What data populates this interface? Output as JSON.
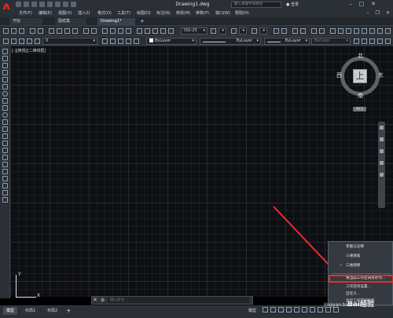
{
  "app": {
    "logo_letter": "A",
    "doc_title": "Drawing1.dwg",
    "search_placeholder": "键入关键字或短语",
    "user_label": "登录"
  },
  "menu": {
    "items": [
      "文件(F)",
      "编辑(E)",
      "视图(V)",
      "插入(I)",
      "格式(O)",
      "工具(T)",
      "绘图(D)",
      "标注(N)",
      "修改(M)",
      "参数(P)",
      "窗口(W)",
      "帮助(H)"
    ]
  },
  "tabs": [
    {
      "label": "开始"
    },
    {
      "label": "图纸集"
    },
    {
      "label": "Drawing1*"
    }
  ],
  "toolbar1": {
    "text_style": "ISO-25"
  },
  "toolbar2": {
    "layer": "0",
    "color": "ByLayer",
    "linetype": "ByLayer",
    "lineweight": "ByLayer",
    "plotstyle": "ByColor"
  },
  "viewport": {
    "label": "[-][俯视][二维线框]"
  },
  "viewcube": {
    "north": "北",
    "south": "南",
    "east": "东",
    "west": "西",
    "face": "上",
    "wcs": "WCS"
  },
  "ucs": {
    "x": "X",
    "y": "Y"
  },
  "command": {
    "placeholder": "键入命令"
  },
  "workspace_menu": {
    "items": [
      {
        "label": "草图与注释",
        "checked": false
      },
      {
        "label": "三维基础",
        "checked": false
      },
      {
        "label": "三维建模",
        "checked": true
      },
      {
        "label": "将当前工作空间另存为...",
        "checked": false
      },
      {
        "label": "工作空间设置...",
        "checked": false
      },
      {
        "label": "自定义...",
        "checked": false
      },
      {
        "label": "显示工作空间标签",
        "checked": false
      }
    ],
    "checkmark": "✓"
  },
  "layout_tabs": [
    {
      "label": "模型"
    },
    {
      "label": "布局1"
    },
    {
      "label": "布局2"
    }
  ],
  "status": {
    "model_label": "模型"
  },
  "watermark": {
    "logo": "Bai经验",
    "url": "jingyan.baidu.com"
  },
  "colors": {
    "accent_red": "#e52d2d",
    "canvas_bg": "#0d0f12"
  }
}
